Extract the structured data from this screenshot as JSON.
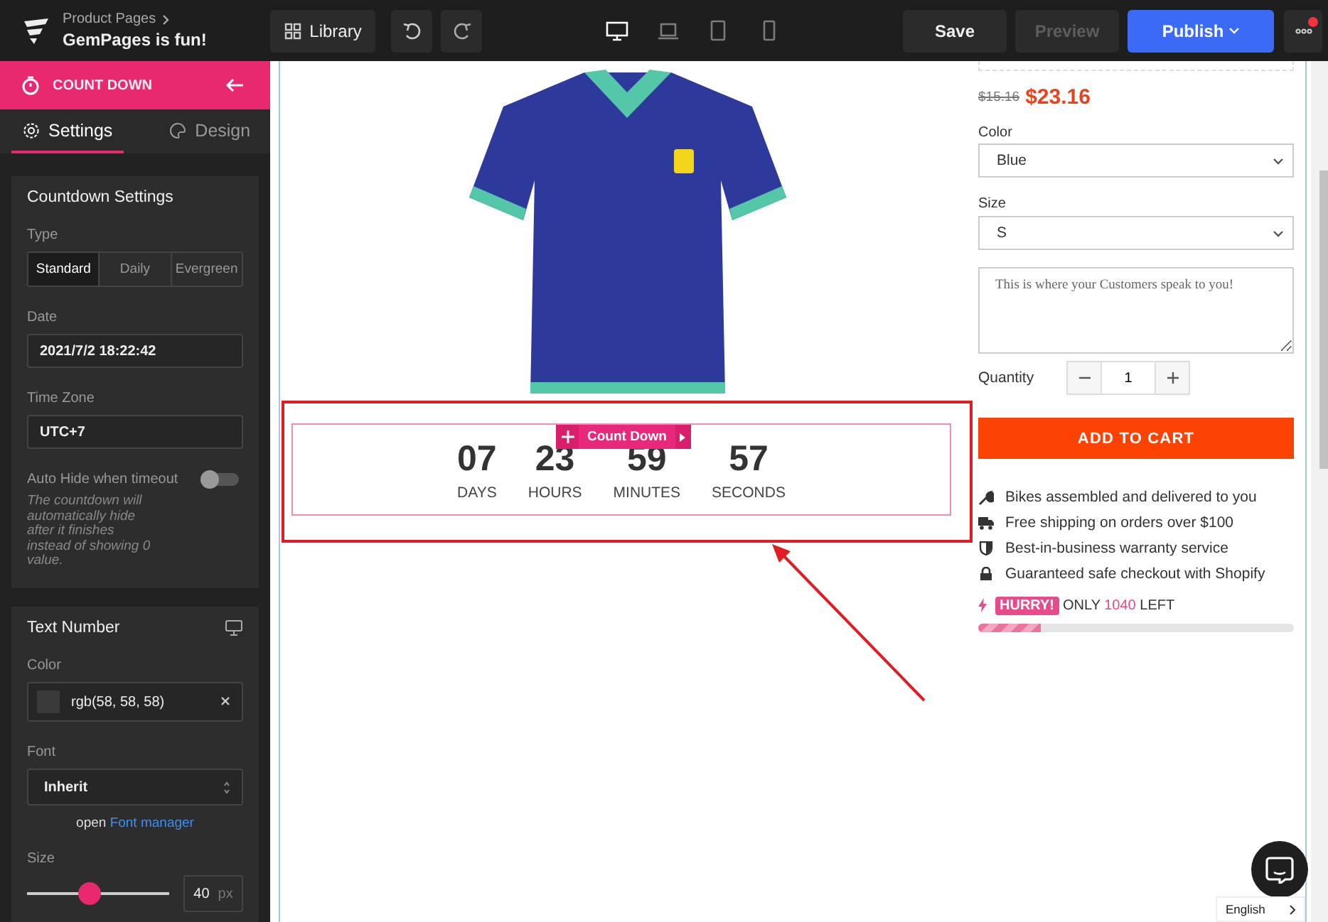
{
  "topbar": {
    "breadcrumb": "Product Pages",
    "page_title": "GemPages is fun!",
    "library": "Library",
    "devices": [
      {
        "kind": "desktop",
        "selected": true
      },
      {
        "kind": "laptop",
        "selected": false
      },
      {
        "kind": "tablet",
        "selected": false
      },
      {
        "kind": "mobile",
        "selected": false
      }
    ],
    "save": "Save",
    "preview": {
      "label": "Preview",
      "disabled": true
    },
    "publish": "Publish",
    "more_notification": true
  },
  "sidebar": {
    "header": "COUNT DOWN",
    "tabs": [
      {
        "label": "Settings",
        "selected": true
      },
      {
        "label": "Design",
        "selected": false
      }
    ],
    "countdown_settings": {
      "title": "Countdown Settings",
      "type_label": "Type",
      "types": [
        {
          "label": "Standard",
          "selected": true
        },
        {
          "label": "Daily",
          "selected": false
        },
        {
          "label": "Evergreen",
          "selected": false
        }
      ],
      "date_label": "Date",
      "date": "2021/7/2 18:22:42",
      "timezone_label": "Time Zone",
      "timezone": "UTC+7",
      "auto_hide_label": "Auto Hide when timeout",
      "auto_hide": false,
      "auto_hide_help": "The countdown will automatically hide after it finishes instead of showing 0 value."
    },
    "text_number": {
      "title": "Text Number",
      "color_label": "Color",
      "color_value": "rgb(58, 58, 58)",
      "font_label": "Font",
      "font": "Inherit",
      "font_manager_prefix": "open",
      "font_manager_link": "Font manager",
      "size_label": "Size",
      "size": {
        "level": 0.43,
        "value": "40",
        "unit": "px"
      }
    }
  },
  "canvas": {
    "countdown": {
      "toolbar_label": "Count Down",
      "units": [
        {
          "value": "07",
          "label": "DAYS"
        },
        {
          "value": "23",
          "label": "HOURS"
        },
        {
          "value": "59",
          "label": "MINUTES"
        },
        {
          "value": "57",
          "label": "SECONDS"
        }
      ]
    },
    "product": {
      "old_price": "$15.16",
      "price": "$23.16",
      "options": [
        {
          "label": "Color",
          "value": "Blue"
        },
        {
          "label": "Size",
          "value": "S"
        }
      ],
      "note_placeholder": "This is where your Customers speak to you!",
      "quantity_label": "Quantity",
      "quantity": "1",
      "add_to_cart": "ADD TO CART",
      "features": [
        {
          "kind": "wrench",
          "text": "Bikes assembled and delivered to you"
        },
        {
          "kind": "truck",
          "text": "Free shipping on orders over $100"
        },
        {
          "kind": "shield",
          "text": "Best-in-business warranty service"
        },
        {
          "kind": "lock",
          "text": "Guaranteed safe checkout with Shopify"
        }
      ],
      "stock": {
        "badge": "HURRY!",
        "before": "ONLY",
        "count": "1040",
        "after": "LEFT",
        "level": 0.2
      }
    },
    "language": "English"
  }
}
